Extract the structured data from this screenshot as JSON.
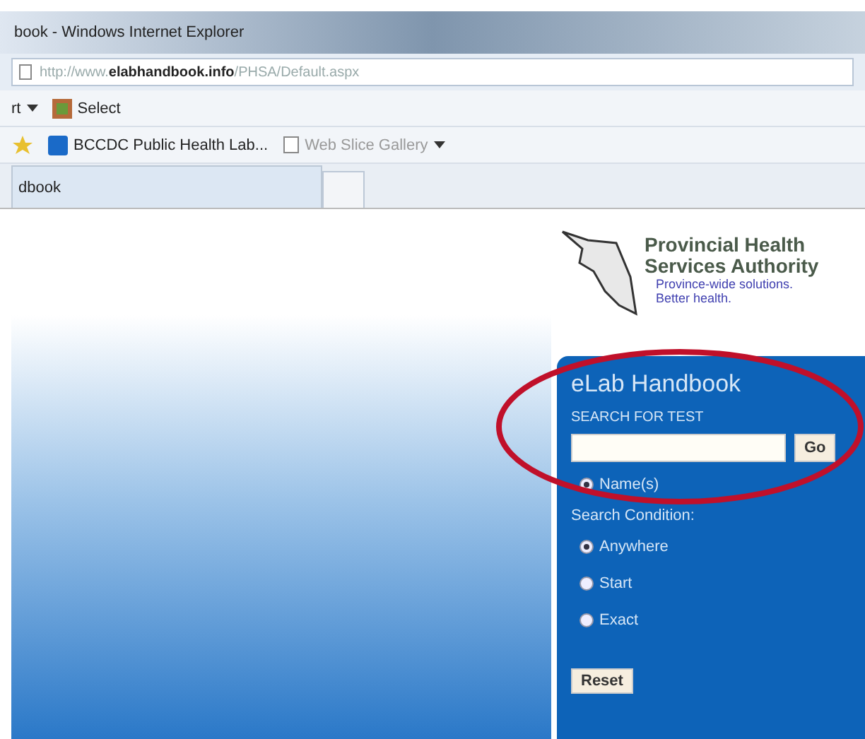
{
  "window": {
    "title": "book - Windows Internet Explorer"
  },
  "address_bar": {
    "prefix": "http://www.",
    "domain": "elabhandbook.info",
    "path": "/PHSA/Default.aspx"
  },
  "command_bar": {
    "items": [
      {
        "label": "rt",
        "kind": "dropdown"
      },
      {
        "label": "Select",
        "kind": "icon"
      }
    ]
  },
  "favorites_bar": {
    "items": [
      {
        "label": "BCCDC Public Health Lab...",
        "kind": "site"
      },
      {
        "label": "Web Slice Gallery",
        "kind": "gallery"
      }
    ]
  },
  "tabs": [
    {
      "label": "dbook",
      "selected": true
    },
    {
      "selected": false
    }
  ],
  "logo": {
    "name_line_1": "Provincial Health",
    "name_line_2": "Services Authority",
    "tagline_1": "Province-wide solutions.",
    "tagline_2": "Better health."
  },
  "panel": {
    "title": "eLab Handbook",
    "search_label": "SEARCH FOR TEST",
    "go_button": "Go",
    "search_by": [
      {
        "label": "Name(s)",
        "selected": true
      }
    ],
    "condition_label": "Search Condition:",
    "conditions": [
      {
        "label": "Anywhere",
        "selected": true
      },
      {
        "label": "Start",
        "selected": false
      },
      {
        "label": "Exact",
        "selected": false
      }
    ],
    "reset_button": "Reset"
  }
}
